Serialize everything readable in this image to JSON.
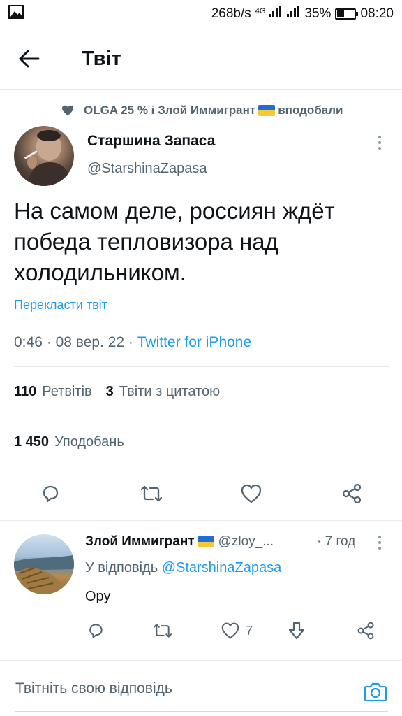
{
  "status_bar": {
    "network_speed": "268b/s",
    "network_type": "4G",
    "battery_percent": "35%",
    "battery_level": 0.35,
    "time": "08:20",
    "icons": [
      "gallery-icon",
      "signal-icon",
      "signal-icon",
      "battery-icon"
    ]
  },
  "header": {
    "title": "Твіт",
    "back_icon": "arrow-left-icon"
  },
  "liked_by": {
    "names": "OLGA 25 % і Злой Иммигрант",
    "suffix": "вподобали",
    "icon": "heart-filled-icon"
  },
  "tweet": {
    "author_name": "Старшина Запаса",
    "author_handle": "@StarshinaZapasa",
    "text": "На самом деле, россиян ждёт победа тепловизора над холодильником.",
    "translate_label": "Перекласти твіт",
    "time": "0:46",
    "date": "08 вер. 22",
    "source": "Twitter for iPhone",
    "separator": "·"
  },
  "stats": {
    "retweets_count": "110",
    "retweets_label": "Ретвітів",
    "quotes_count": "3",
    "quotes_label": "Твіти з цитатою",
    "likes_count": "1 450",
    "likes_label": "Уподобань"
  },
  "actions": [
    "reply-icon",
    "retweet-icon",
    "like-icon",
    "share-icon"
  ],
  "reply": {
    "author_name": "Злой Иммигрант",
    "author_handle": "@zloy_...",
    "time": "· 7 год",
    "reply_to_prefix": "У відповідь",
    "reply_to_handle": "@StarshinaZapasa",
    "text": "Ору",
    "like_count": "7"
  },
  "compose": {
    "placeholder": "Твітніть свою відповідь",
    "camera_icon": "camera-icon"
  },
  "colors": {
    "accent": "#1d9bf0",
    "text_primary": "#0f1419",
    "text_secondary": "#536471",
    "divider": "#e7eaec",
    "flag_blue": "#1e6fd1",
    "flag_yellow": "#f7c73a"
  }
}
